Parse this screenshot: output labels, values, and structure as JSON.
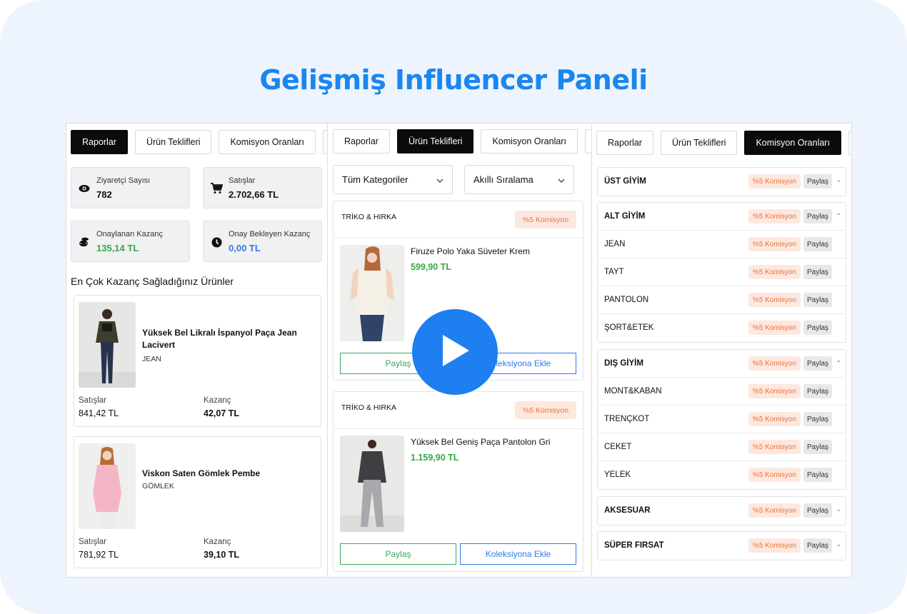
{
  "headline": "Gelişmiş Influencer Paneli",
  "tabs": [
    "Raporlar",
    "Ürün Teklifleri",
    "Komisyon Oranları"
  ],
  "reports": {
    "stats": [
      {
        "label": "Ziyaretçi Sayısı",
        "value": "782",
        "icon": "eye-icon"
      },
      {
        "label": "Satışlar",
        "value": "2.702,66 TL",
        "icon": "cart-icon"
      },
      {
        "label": "Onaylanan Kazanç",
        "value": "135,14 TL",
        "icon": "coins-icon",
        "color": "#35a84a"
      },
      {
        "label": "Onay Bekleyen Kazanç",
        "value": "0,00 TL",
        "icon": "clock-icon",
        "color": "#2f7be8"
      }
    ],
    "section_title": "En Çok Kazanç Sağladığınız Ürünler",
    "products": [
      {
        "name": "Yüksek Bel Likralı İspanyol Paça Jean Lacivert",
        "category": "JEAN",
        "sales_label": "Satışlar",
        "sales": "841,42 TL",
        "earn_label": "Kazanç",
        "earn": "42,07 TL"
      },
      {
        "name": "Viskon Saten Gömlek Pembe",
        "category": "GÖMLEK",
        "sales_label": "Satışlar",
        "sales": "781,92 TL",
        "earn_label": "Kazanç",
        "earn": "39,10 TL"
      }
    ]
  },
  "offers": {
    "category_select": "Tüm Kategoriler",
    "sort_select": "Akıllı Sıralama",
    "items": [
      {
        "category": "TRİKO & HIRKA",
        "badge": "%5 Komisyon",
        "name": "Firuze Polo Yaka Süveter Krem",
        "price": "599,90 TL",
        "share": "Paylaş",
        "collection": "Koleksiyona Ekle"
      },
      {
        "category": "TRİKO & HIRKA",
        "badge": "%5 Komisyon",
        "name": "Yüksek Bel Geniş Paça Pantolon Gri",
        "price": "1.159,90 TL",
        "share": "Paylaş",
        "collection": "Koleksiyona Ekle"
      }
    ]
  },
  "commissions": {
    "badge": "%5 Komisyon",
    "share": "Paylaş",
    "groups": [
      {
        "name": "ÜST GİYİM",
        "expanded": false,
        "children": []
      },
      {
        "name": "ALT GİYİM",
        "expanded": true,
        "children": [
          "JEAN",
          "TAYT",
          "PANTOLON",
          "ŞORT&ETEK"
        ]
      },
      {
        "name": "DIŞ GİYİM",
        "expanded": true,
        "children": [
          "MONT&KABAN",
          "TRENÇKOT",
          "CEKET",
          "YELEK"
        ]
      },
      {
        "name": "AKSESUAR",
        "expanded": false,
        "children": []
      },
      {
        "name": "SÜPER FIRSAT",
        "expanded": false,
        "children": []
      }
    ]
  },
  "colors": {
    "accent": "#1a86f0",
    "green": "#35a84a",
    "blue": "#2f7be8",
    "badge_text": "#e8743b",
    "badge_bg": "#fde8df"
  }
}
